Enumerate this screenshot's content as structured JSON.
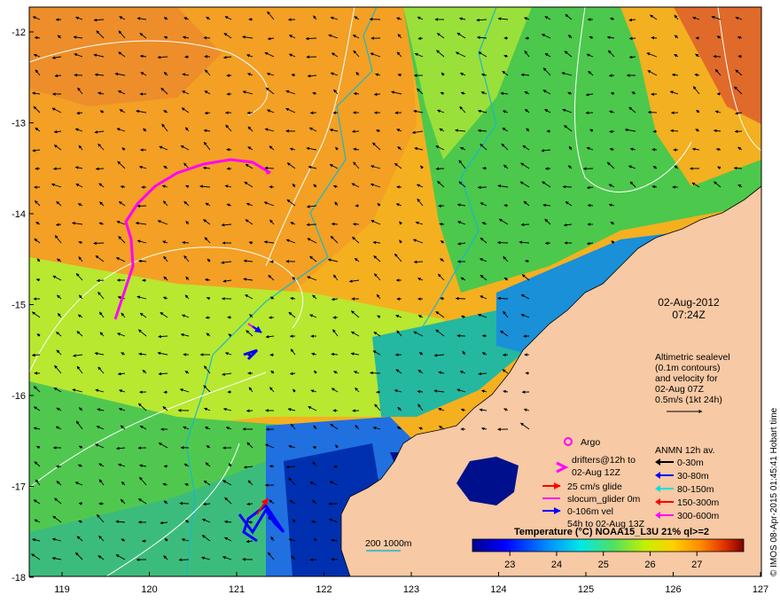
{
  "map": {
    "date": "02-Aug-2012",
    "time": "07:24Z",
    "lon_ticks": [
      "119",
      "120",
      "121",
      "122",
      "123",
      "124",
      "125",
      "126",
      "127"
    ],
    "lat_ticks": [
      "-12",
      "-13",
      "-14",
      "-15",
      "-16",
      "-17",
      "-18"
    ],
    "land_color": "#f7c9a4",
    "side_credit": "© IMOS 08-Apr-2015 01:45:41 Hobart time"
  },
  "altimetry_note": {
    "lines": [
      "Altimetric sealevel",
      "(0.1m contours)",
      "and velocity for",
      "02-Aug 07Z",
      "0.5m/s (1kt 24h)"
    ]
  },
  "legend": {
    "argo": "Argo",
    "drifters": [
      "drifters@12h to",
      "02-Aug 12Z"
    ],
    "glider_glide": "25 cm/s glide",
    "glider_surface": "slocum_glider 0m",
    "glider_vel": [
      "0-106m vel",
      "54h to 02-Aug 13Z"
    ],
    "anmn_title": "ANMN 12h av.",
    "anmn_items": [
      {
        "label": "0-30m",
        "color": "#000000"
      },
      {
        "label": "30-80m",
        "color": "#0000ff"
      },
      {
        "label": "80-150m",
        "color": "#00e0e0"
      },
      {
        "label": "150-300m",
        "color": "#ff0000"
      },
      {
        "label": "300-600m",
        "color": "#ff00ff"
      }
    ],
    "colors": {
      "drifter": "#ff00ff",
      "glide": "#ff0000",
      "surface": "#ff00ff",
      "vel": "#0000ff",
      "argo": "#ff00ff"
    }
  },
  "isobath": {
    "label": "200  1000m",
    "color": "#19b8c8"
  },
  "colorbar": {
    "title": "Temperature (°C) NOAA15_L3U 21% ql>=2",
    "ticks": [
      "23",
      "24",
      "25",
      "26",
      "27"
    ],
    "range": [
      22.2,
      28.0
    ]
  }
}
